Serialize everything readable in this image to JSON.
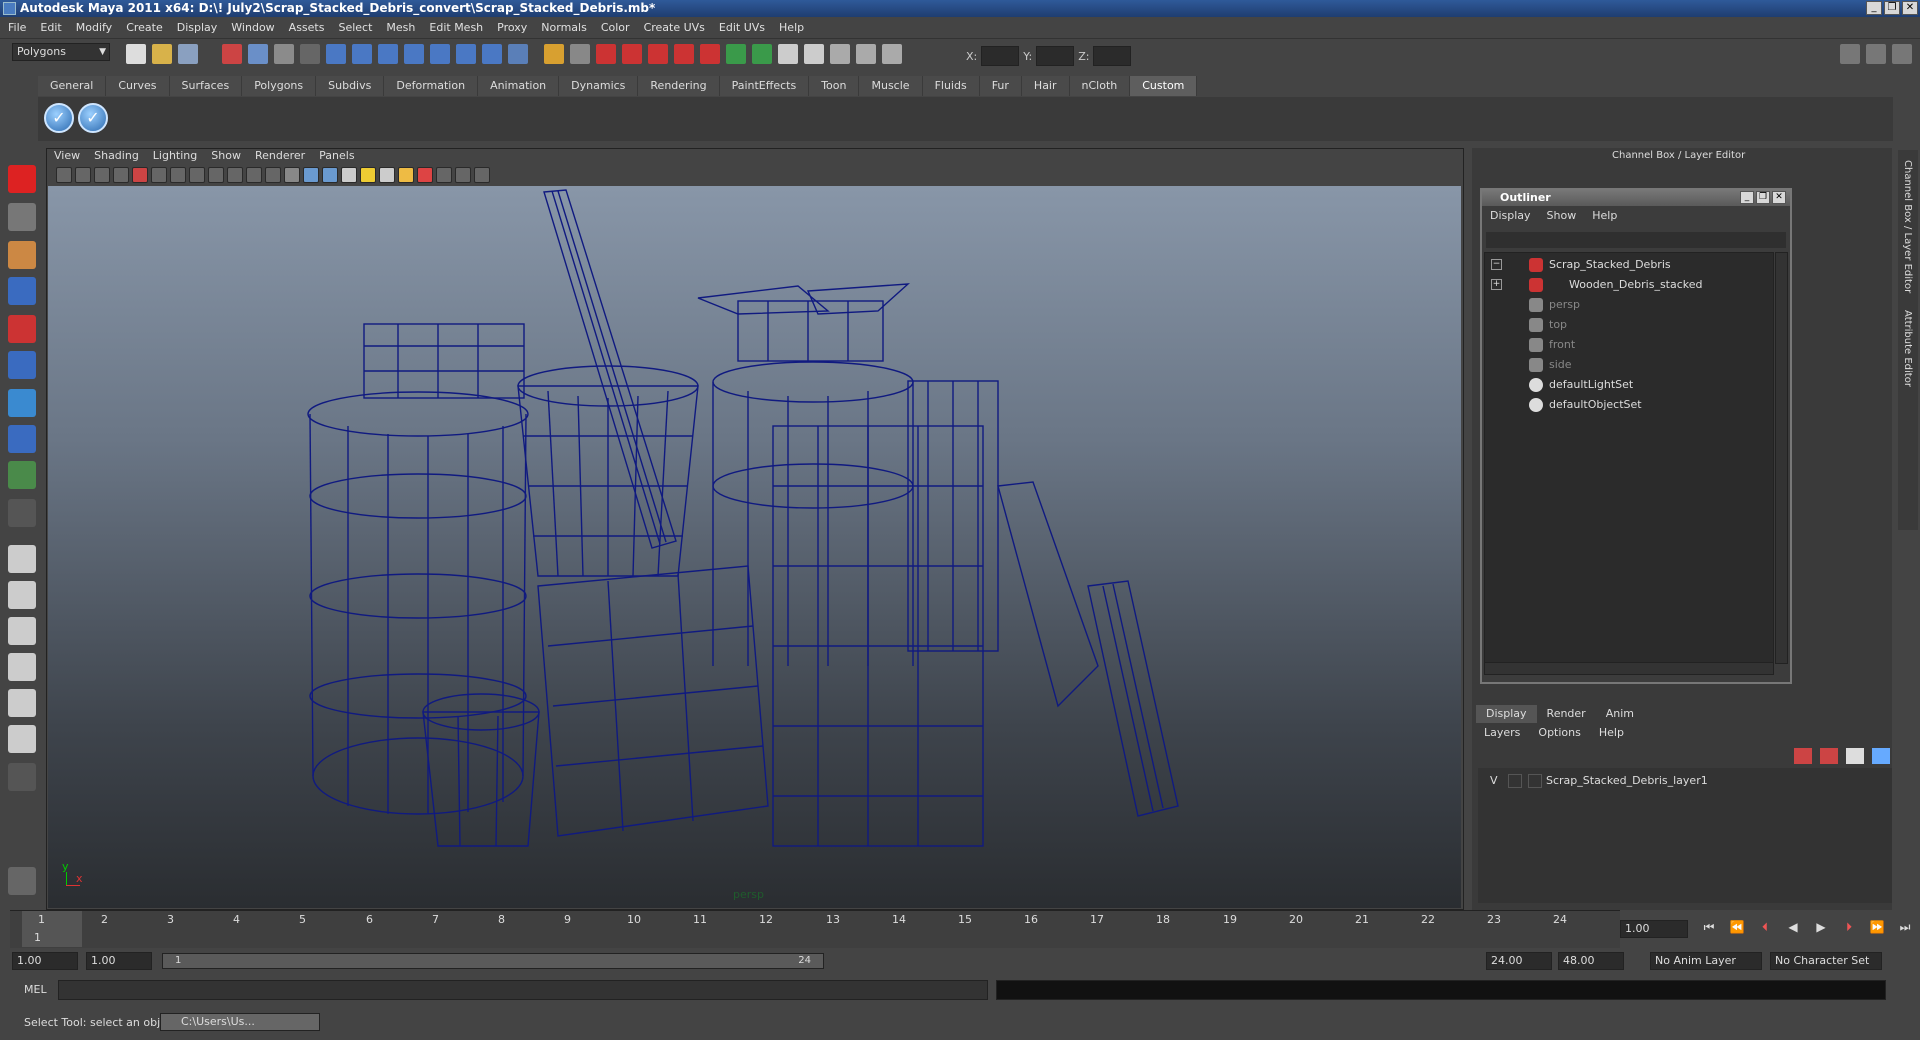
{
  "window": {
    "title": "Autodesk Maya 2011 x64: D:\\! July2\\Scrap_Stacked_Debris_convert\\Scrap_Stacked_Debris.mb*",
    "buttons": [
      "_",
      "❐",
      "✕"
    ]
  },
  "menubar": [
    "File",
    "Edit",
    "Modify",
    "Create",
    "Display",
    "Window",
    "Assets",
    "Select",
    "Mesh",
    "Edit Mesh",
    "Proxy",
    "Normals",
    "Color",
    "Create UVs",
    "Edit UVs",
    "Help"
  ],
  "statusline": {
    "menuset": "Polygons",
    "x_label": "X:",
    "y_label": "Y:",
    "z_label": "Z:"
  },
  "shelf": {
    "tabs": [
      "General",
      "Curves",
      "Surfaces",
      "Polygons",
      "Subdivs",
      "Deformation",
      "Animation",
      "Dynamics",
      "Rendering",
      "PaintEffects",
      "Toon",
      "Muscle",
      "Fluids",
      "Fur",
      "Hair",
      "nCloth",
      "Custom"
    ],
    "active_tab": "Custom"
  },
  "viewport": {
    "menu": [
      "View",
      "Shading",
      "Lighting",
      "Show",
      "Renderer",
      "Panels"
    ],
    "camera_label": "persp",
    "axis_y": "y",
    "axis_x": "x",
    "wire_color": "#101a80"
  },
  "channel_box": {
    "title": "Channel Box / Layer Editor",
    "side_tabs": [
      "Channel Box / Layer Editor",
      "Attribute Editor"
    ]
  },
  "outliner": {
    "title": "Outliner",
    "menu": [
      "Display",
      "Show",
      "Help"
    ],
    "items": [
      {
        "label": "Scrap_Stacked_Debris",
        "dim": false,
        "expand": "−",
        "icon": "transform-icon"
      },
      {
        "label": "Wooden_Debris_stacked",
        "dim": false,
        "expand": "+",
        "icon": "transform-icon"
      },
      {
        "label": "persp",
        "dim": true,
        "icon": "camera-icon"
      },
      {
        "label": "top",
        "dim": true,
        "icon": "camera-icon"
      },
      {
        "label": "front",
        "dim": true,
        "icon": "camera-icon"
      },
      {
        "label": "side",
        "dim": true,
        "icon": "camera-icon"
      },
      {
        "label": "defaultLightSet",
        "dim": false,
        "icon": "set-icon"
      },
      {
        "label": "defaultObjectSet",
        "dim": false,
        "icon": "set-icon"
      }
    ]
  },
  "layer_editor": {
    "tabs": [
      "Display",
      "Render",
      "Anim"
    ],
    "active_tab": "Display",
    "menu": [
      "Layers",
      "Options",
      "Help"
    ],
    "layers": [
      {
        "visible": "V",
        "name": "Scrap_Stacked_Debris_layer1"
      }
    ]
  },
  "timeline": {
    "ticks": [
      "1",
      "2",
      "3",
      "4",
      "5",
      "6",
      "7",
      "8",
      "9",
      "10",
      "11",
      "12",
      "13",
      "14",
      "15",
      "16",
      "17",
      "18",
      "19",
      "20",
      "21",
      "22",
      "23",
      "24"
    ],
    "current_frame": "1.00",
    "current_marker": "1"
  },
  "range": {
    "start": "1.00",
    "anim_start": "1.00",
    "slider_start": "1",
    "slider_end": "24",
    "anim_end": "24.00",
    "end": "48.00",
    "anim_layer": "No Anim Layer",
    "character_set": "No Character Set"
  },
  "command": {
    "mel_label": "MEL"
  },
  "help_line": {
    "text": "Select Tool: select an object",
    "taskbar": "C:\\Users\\Us..."
  }
}
